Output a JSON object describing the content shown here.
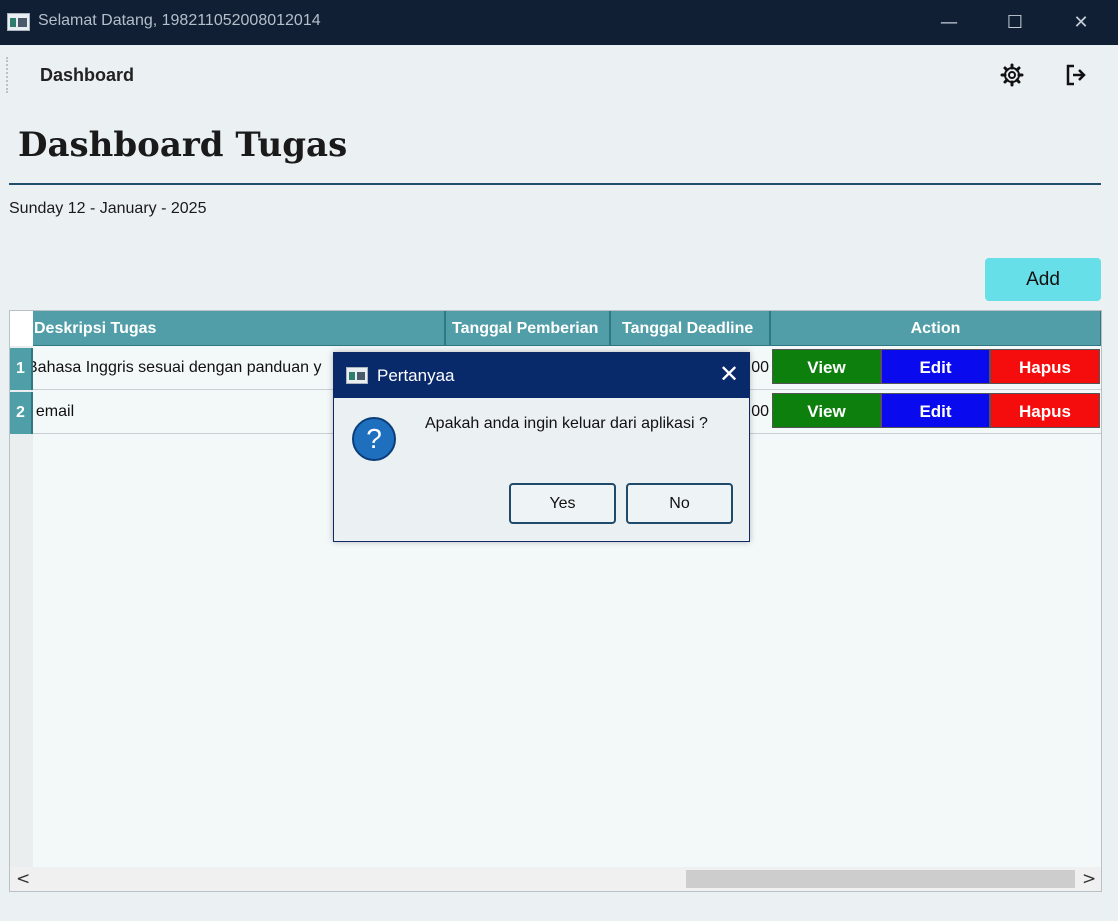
{
  "window": {
    "title": "Selamat Datang, 198211052008012014",
    "minimize_glyph": "—",
    "maximize_glyph": "☐",
    "close_glyph": "✕"
  },
  "toolbar": {
    "title": "Dashboard",
    "icons": [
      "gear-icon",
      "logout-icon"
    ]
  },
  "page": {
    "title": "Dashboard Tugas",
    "date": "Sunday 12 - January - 2025",
    "add_label": "Add"
  },
  "table": {
    "columns": [
      "Deskripsi Tugas",
      "Tanggal Pemberian",
      "Tanggal Deadline",
      "Action"
    ],
    "rows": [
      {
        "num": "1",
        "desc": "Bahasa Inggris sesuai dengan panduan y",
        "deadline_tail": "00"
      },
      {
        "num": "2",
        "desc": "t email",
        "deadline_tail": "00"
      }
    ],
    "actions": {
      "view": "View",
      "edit": "Edit",
      "delete": "Hapus"
    },
    "scroll_left": "<",
    "scroll_right": ">"
  },
  "dialog": {
    "title": "Pertanyaa",
    "message": "Apakah anda ingin keluar dari aplikasi ?",
    "icon_glyph": "?",
    "close_glyph": "✕",
    "yes_label": "Yes",
    "no_label": "No"
  },
  "colors": {
    "titlebar": "#101f33",
    "header": "#519ea9",
    "view": "#0c7f0c",
    "edit": "#0a0aee",
    "hapus": "#f50d0d",
    "add": "#67dfe8",
    "dialog_title": "#082a6b"
  }
}
